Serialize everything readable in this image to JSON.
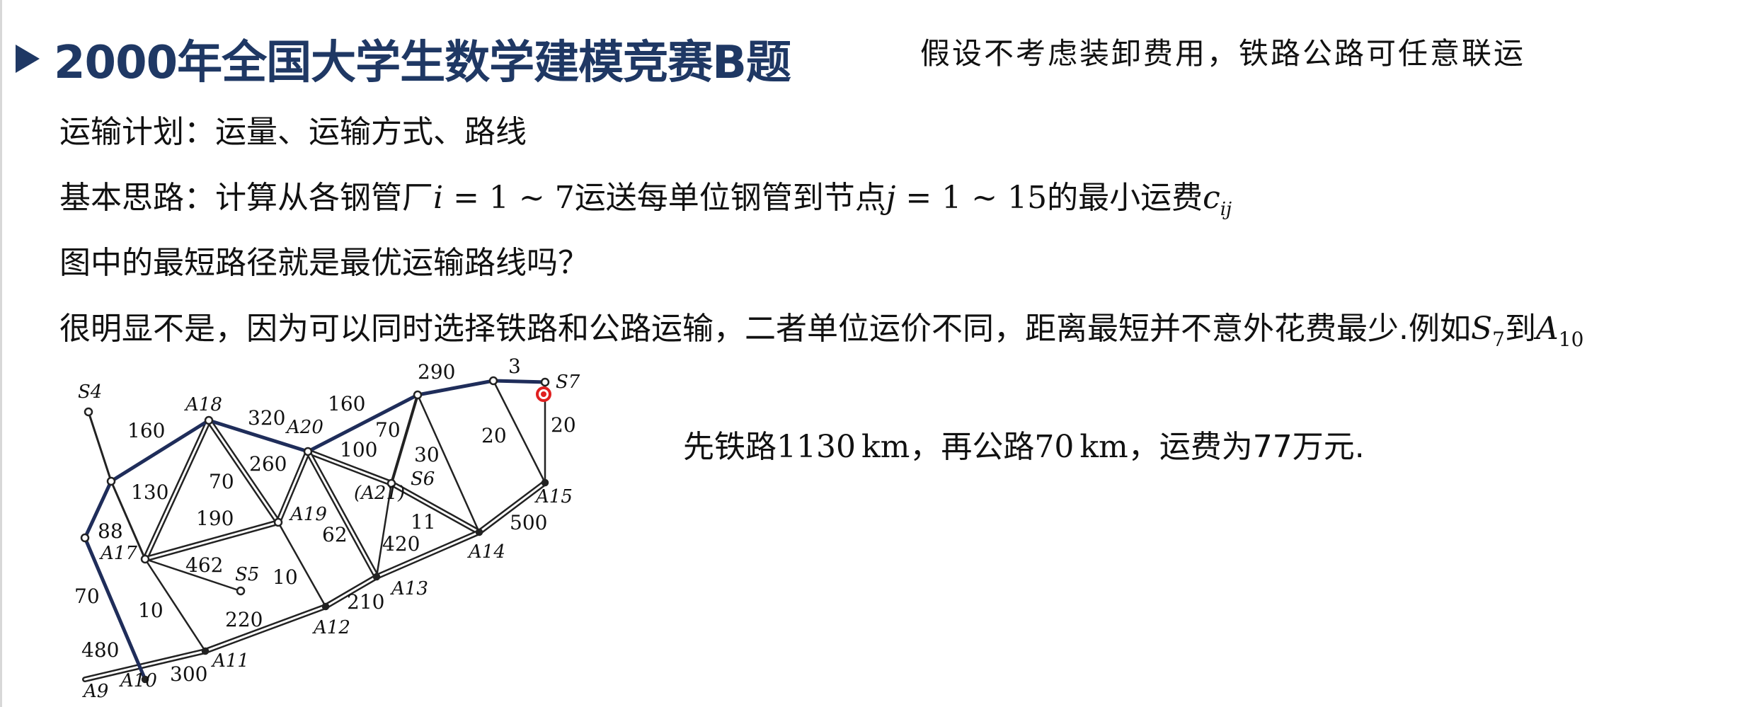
{
  "slide": {
    "title": "2000年全国大学生数学建模竞赛B题",
    "assumption": "假设不考虑装卸费用，铁路公路可任意联运",
    "line1": "运输计划：运量、运输方式、路线",
    "line2_prefix": "基本思路：计算从各钢管厂",
    "line2_mid1": "运送每单位钢管到节点",
    "line2_mid2": "的最小运费",
    "line3": "图中的最短路径就是最优运输路线吗？",
    "line4_prefix": "很明显不是，因为可以同时选择铁路和公路运输，二者单位运价不同，距离最短并不意外花费最少.例如",
    "line4_mid": "到",
    "answer_prefix": "先铁路",
    "answer_rail_km": "1130",
    "answer_mid": "，再公路",
    "answer_road_km": "70",
    "answer_suffix": "，运费为77万元.",
    "unit_km": "km"
  },
  "diagram": {
    "nodes": [
      "S4",
      "A18",
      "A20",
      "S7",
      "A17",
      "A19",
      "S6",
      "(A21)",
      "A15",
      "S5",
      "A14",
      "A13",
      "A12",
      "A11",
      "A10",
      "A9"
    ],
    "edge_labels": [
      "160",
      "320",
      "160",
      "290",
      "3",
      "20",
      "20",
      "70",
      "130",
      "190",
      "260",
      "100",
      "70",
      "30",
      "88",
      "462",
      "10",
      "62",
      "420",
      "11",
      "500",
      "10",
      "220",
      "210",
      "300",
      "480",
      "70"
    ]
  },
  "colors": {
    "title": "#1f3864",
    "highlight": "#1f2d5a",
    "marker": "#e02020"
  }
}
